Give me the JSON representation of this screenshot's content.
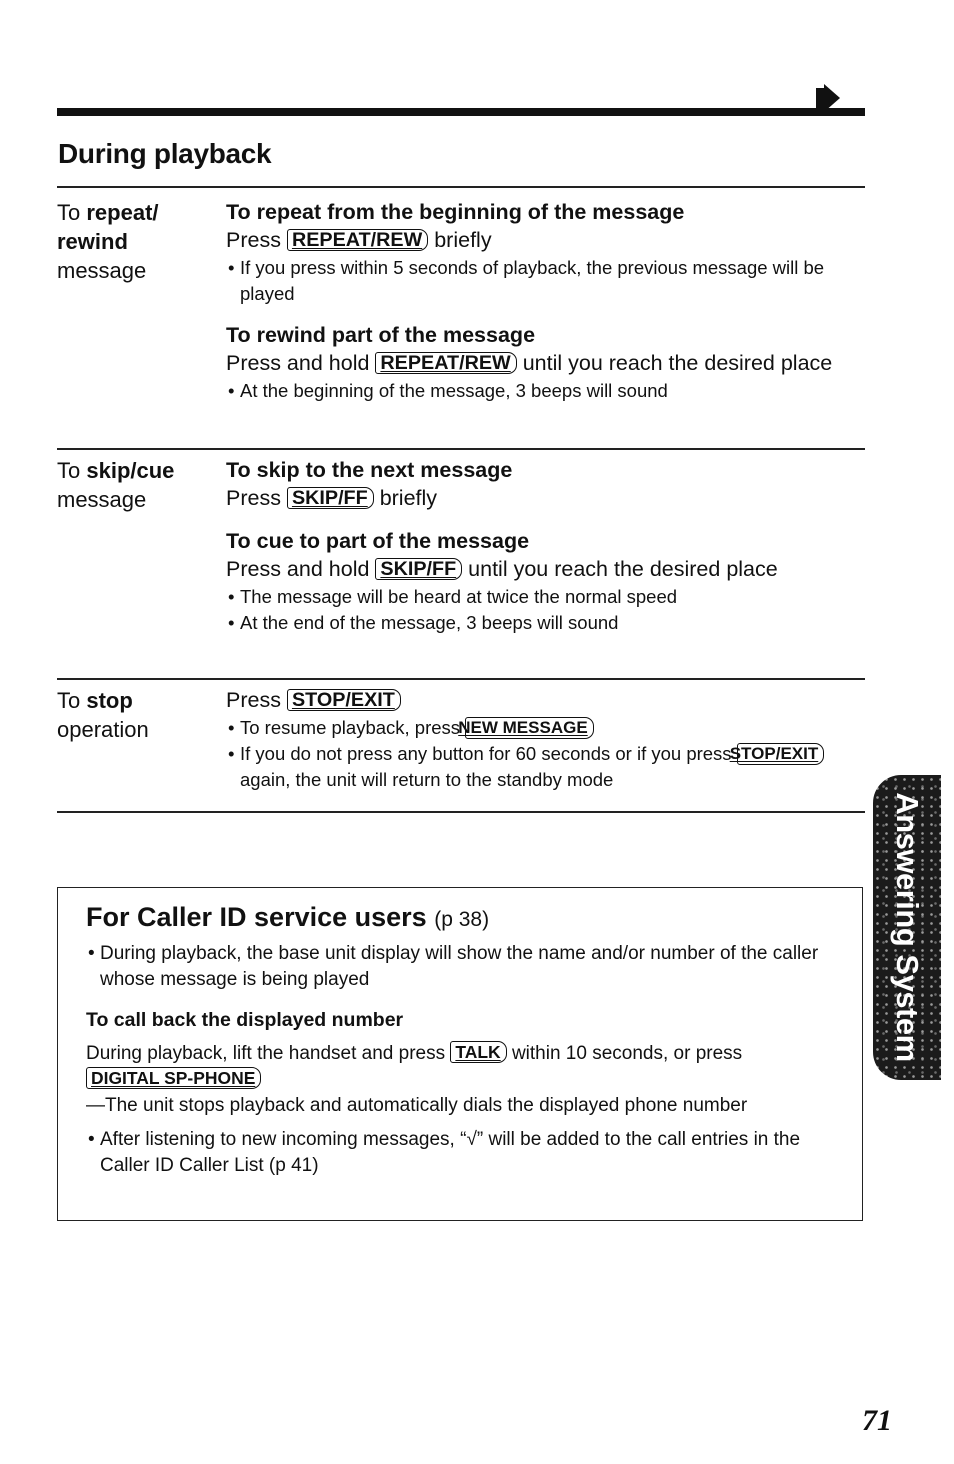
{
  "page": {
    "continue_arrow": "right-arrow-icon",
    "section_title": "During playback",
    "page_number": "71",
    "side_tab": "Answering System"
  },
  "rows": [
    {
      "label_prefix": "To ",
      "label_bold": "repeat/ rewind",
      "label_suffix": "message",
      "blocks": [
        {
          "heading": "To repeat from the beginning of the message",
          "instruction_pre": "Press ",
          "key": "REPEAT/REW",
          "instruction_post": " briefly",
          "notes": [
            "If you press within 5 seconds of playback, the previous message will be played"
          ]
        },
        {
          "heading": "To rewind part of the message",
          "instruction_pre": "Press and hold ",
          "key": "REPEAT/REW",
          "instruction_post": " until you reach the desired place",
          "notes": [
            "At the beginning of the message, 3 beeps will sound"
          ]
        }
      ]
    },
    {
      "label_prefix": "To ",
      "label_bold": "skip/cue",
      "label_suffix": "message",
      "blocks": [
        {
          "heading": "To skip to the next message",
          "instruction_pre": "Press ",
          "key": "SKIP/FF",
          "instruction_post": " briefly",
          "notes": []
        },
        {
          "heading": "To cue to part of the message",
          "instruction_pre": "Press and hold ",
          "key": "SKIP/FF",
          "instruction_post": " until you reach the desired place",
          "notes": [
            "The message will be heard at twice the normal speed",
            "At the end of the message, 3 beeps will sound"
          ]
        }
      ]
    },
    {
      "label_prefix": "To ",
      "label_bold": "stop",
      "label_suffix": "operation",
      "instruction_pre": "Press ",
      "key": "STOP/EXIT",
      "note1_pre": "To resume playback, press ",
      "note1_key": "NEW MESSAGE",
      "note2_pre": "If you do not press any button for 60 seconds or if you press ",
      "note2_key": "STOP/EXIT",
      "note2_post": " again, the unit will return to the standby mode"
    }
  ],
  "callerid_box": {
    "title": "For Caller ID service users",
    "title_ref": "(p 38)",
    "note1": "During playback, the base unit display will show the name and/or number of the caller whose message is being played",
    "subheading": "To call back the displayed number",
    "para_pre": "During playback, lift the handset and press ",
    "para_key1": "TALK",
    "para_mid": " within 10 seconds, or press ",
    "para_key2": "DIGITAL SP-PHONE",
    "dash_text": "—The unit stops playback and automatically dials the displayed phone number",
    "note2": "After listening to new incoming messages, “√” will be added to the call entries in the Caller ID Caller List (p 41)"
  }
}
